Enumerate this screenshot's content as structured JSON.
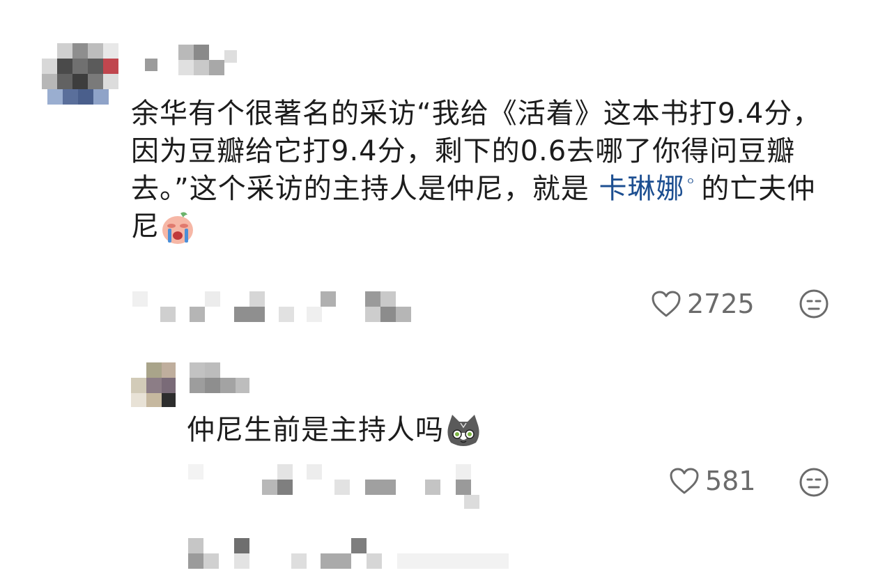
{
  "comment": {
    "text_before_link": "余华有个很著名的采访“我给《活着》这本书打9.4分，因为豆瓣给它打9.4分，剩下的0.6去哪了你得问豆瓣去。”这个采访的主持人是仲尼，就是 ",
    "link_text": "卡琳娜",
    "link_mark": "ᴼ",
    "text_after_link": "的亡夫仲尼",
    "emoji": "crying-face-emoji",
    "likes": "2725"
  },
  "reply": {
    "text": "仲尼生前是主持人吗",
    "emoji": "cat-face-emoji",
    "likes": "581"
  },
  "colors": {
    "text": "#1c1c1c",
    "link": "#1d4f91",
    "meta": "#6b6b6b"
  }
}
